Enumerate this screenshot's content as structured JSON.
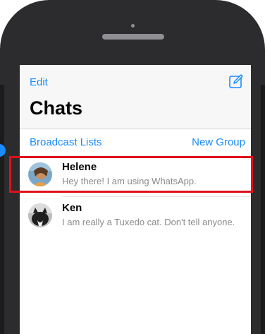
{
  "header": {
    "edit_label": "Edit",
    "title": "Chats",
    "compose_icon": "compose-icon"
  },
  "subbar": {
    "broadcast_label": "Broadcast Lists",
    "new_group_label": "New Group"
  },
  "chats": [
    {
      "name": "Helene",
      "preview": "Hey there! I am using WhatsApp.",
      "highlighted": true
    },
    {
      "name": "Ken",
      "preview": "I am really a Tuxedo cat. Don't tell anyone.",
      "highlighted": false
    }
  ],
  "colors": {
    "accent": "#1a8cff",
    "highlight": "#e0101a",
    "device": "#2c2c2e"
  }
}
